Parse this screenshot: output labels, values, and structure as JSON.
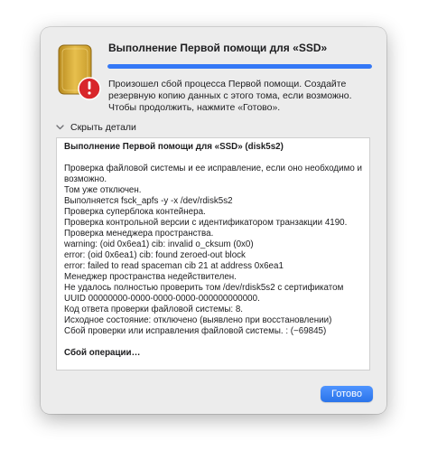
{
  "dialog": {
    "title": "Выполнение Первой помощи для «SSD»",
    "progress_fraction": 1.0,
    "message": "Произошел сбой процесса Первой помощи. Создайте резервную копию данных с этого тома, если возможно. Чтобы продолжить, нажмите «Готово».",
    "details_toggle_label": "Скрыть детали",
    "done_button_label": "Готово",
    "accent_color": "#3478f6"
  },
  "log": {
    "lines": [
      "Выполнение Первой помощи для «SSD» (disk5s2)",
      "",
      "Проверка файловой системы и ее исправление, если оно необходимо и возможно.",
      "Том уже отключен.",
      "Выполняется fsck_apfs -y -x /dev/rdisk5s2",
      "Проверка суперблока контейнера.",
      "Проверка контрольной версии с идентификатором транзакции 4190.",
      "Проверка менеджера пространства.",
      "warning: (oid 0x6ea1) cib: invalid o_cksum (0x0)",
      "error: (oid 0x6ea1) cib: found zeroed-out block",
      "error: failed to read spaceman cib 21 at address 0x6ea1",
      "Менеджер пространства недействителен.",
      "Не удалось полностью проверить том /dev/rdisk5s2 с сертификатом UUID 00000000-0000-0000-0000-000000000000.",
      "Код ответа проверки файловой системы: 8.",
      "Исходное состояние: отключено (выявлено при восстановлении)",
      "Сбой проверки или исправления файловой системы. : (−69845)",
      "",
      "Сбой операции…"
    ],
    "bold_lines": [
      0,
      17
    ]
  }
}
